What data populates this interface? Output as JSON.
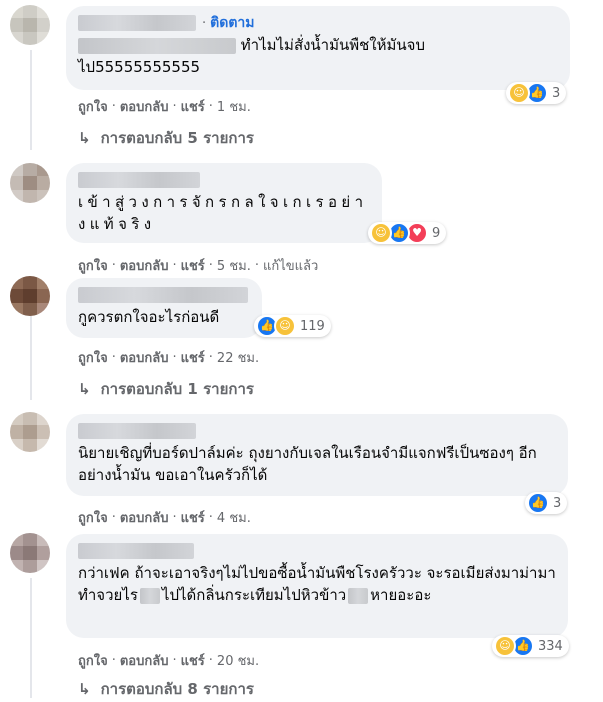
{
  "comments": [
    {
      "follow": "ติดตาม",
      "text_after_blur": " ทำไมไม่สั่งน้ำมันพืชให้มันจบ",
      "text_line2": "ไป55555555555",
      "reaction_icons": [
        "haha-icon",
        "like-icon"
      ],
      "reaction_count": "3",
      "actions": {
        "like": "ถูกใจ",
        "reply": "ตอบกลับ",
        "share": "แชร์",
        "time": "1 ชม."
      },
      "replies": "การตอบกลับ 5 รายการ"
    },
    {
      "text": "เข้าสู่วงการจักรกลใจเกเรอย่างแท้จริง",
      "reaction_icons": [
        "haha-icon",
        "like-icon",
        "love-icon"
      ],
      "reaction_count": "9",
      "actions": {
        "like": "ถูกใจ",
        "reply": "ตอบกลับ",
        "share": "แชร์",
        "time": "5 ชม.",
        "edited": "แก้ไขแล้ว"
      }
    },
    {
      "text": "กูควรตกใจอะไรก่อนดี",
      "reaction_icons": [
        "like-icon",
        "haha-icon"
      ],
      "reaction_count": "119",
      "actions": {
        "like": "ถูกใจ",
        "reply": "ตอบกลับ",
        "share": "แชร์",
        "time": "22 ชม."
      },
      "replies": "การตอบกลับ 1 รายการ"
    },
    {
      "text": "นิยายเชิญที่บอร์ดปาล์มค่ะ ถุงยางกับเจลในเรือนจำมีแจกฟรีเป็นซองๆ อีกอย่างน้ำมัน ขอเอาในครัวก็ได้",
      "reaction_icons": [
        "like-icon"
      ],
      "reaction_count": "3",
      "actions": {
        "like": "ถูกใจ",
        "reply": "ตอบกลับ",
        "share": "แชร์",
        "time": "4 ชม."
      }
    },
    {
      "text_part1": "กว่าเฟค ถ้าจะเอาจริงๆไม่ไปขอซื้อน้ำมันพืชโรงครัววะ จะรอเมียส่งมาม่ามาทำจวยไร",
      "text_part2": "ไปได้กลิ่นกระเทียมไปหิวข้าว",
      "text_part3": "หายอะอะ",
      "reaction_icons": [
        "haha-icon",
        "like-icon"
      ],
      "reaction_count": "334",
      "actions": {
        "like": "ถูกใจ",
        "reply": "ตอบกลับ",
        "share": "แชร์",
        "time": "20 ชม."
      },
      "replies": "การตอบกลับ 8 รายการ"
    }
  ],
  "sep": "·",
  "colors": {
    "accent": "#216fdb",
    "bubble": "#f0f2f5",
    "meta": "#65676b"
  }
}
